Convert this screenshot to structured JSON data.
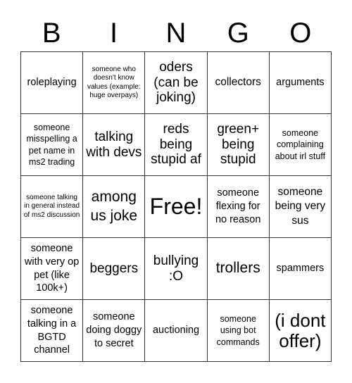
{
  "header": {
    "letters": [
      "B",
      "I",
      "N",
      "G",
      "O"
    ]
  },
  "cells": [
    [
      "roleplaying",
      "someone who doesn't know values (example: huge overpays)",
      "oders (can be joking)",
      "collectors",
      "arguments"
    ],
    [
      "someone misspelling a pet name in ms2 trading",
      "talking with devs",
      "reds being stupid af",
      "green+ being stupid",
      "someone complaining about irl stuff"
    ],
    [
      "someone talking in general instead of ms2 discussion",
      "among us joke",
      "Free!",
      "someone flexing for no reason",
      "someone being very sus"
    ],
    [
      "someone with very op pet (like 100k+)",
      "beggers",
      "bullying :O",
      "trollers",
      "spammers"
    ],
    [
      "someone talking in a BGTD channel",
      "someone doing doggy to secret",
      "auctioning",
      "someone using bot commands",
      "(i dont offer)"
    ]
  ]
}
